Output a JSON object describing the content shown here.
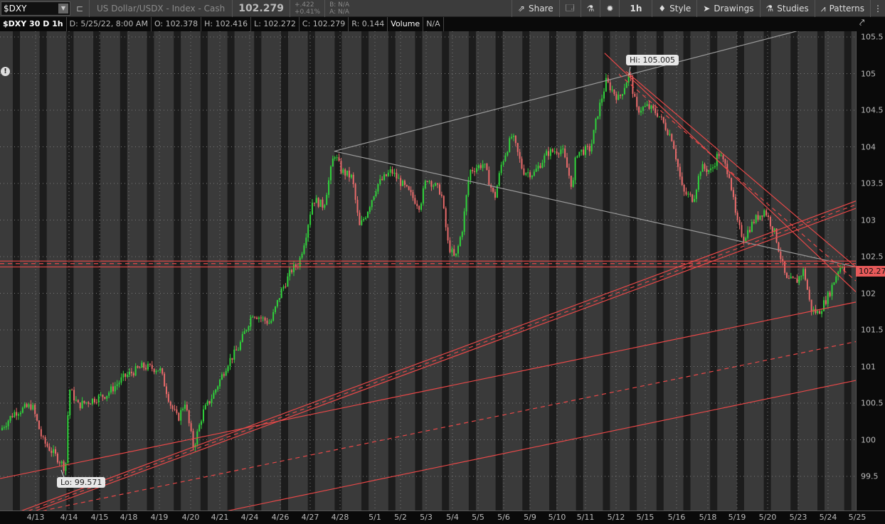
{
  "header": {
    "symbol": "$DXY",
    "description": "US Dollar/USDX - Index - Cash",
    "last": "102.279",
    "change": "+.422",
    "change_pct": "+0.41%",
    "bid": "B: N/A",
    "ask": "A: N/A"
  },
  "toolbar": {
    "share": "Share",
    "timeframe": "1h",
    "style": "Style",
    "drawings": "Drawings",
    "studies": "Studies",
    "patterns": "Patterns"
  },
  "infobar": {
    "title": "$DXY 30 D 1h",
    "date": "D: 5/25/22, 8:00 AM",
    "open": "O: 102.378",
    "high": "H: 102.416",
    "low": "L: 102.272",
    "close": "C: 102.279",
    "range": "R: 0.144",
    "volume_label": "Volume",
    "volume": "N/A"
  },
  "alert": "!",
  "colors": {
    "up": "#2fd13a",
    "down": "#e86a6a",
    "drawing": "#e84848",
    "trendline": "#9a9a9a",
    "background": "#3a3a3a",
    "band": "#1c1c1c"
  },
  "chart_data": {
    "type": "candlestick",
    "symbol": "$DXY",
    "period": "30 D",
    "interval": "1h",
    "current_price": "102.27",
    "hi_label": "Hi: 105.005",
    "lo_label": "Lo: 99.571",
    "y_ticks": [
      "105.5",
      "105",
      "104.5",
      "104",
      "103.5",
      "103",
      "102.5",
      "102",
      "101.5",
      "101",
      "100.5",
      "100",
      "99.5"
    ],
    "x_ticks": [
      "4/13",
      "4/14",
      "4/15",
      "4/18",
      "4/19",
      "4/20",
      "4/21",
      "4/24",
      "4/26",
      "4/27",
      "4/28",
      "5/1",
      "5/2",
      "5/3",
      "5/4",
      "5/5",
      "5/6",
      "5/9",
      "5/10",
      "5/11",
      "5/12",
      "5/15",
      "5/16",
      "5/18",
      "5/19",
      "5/20",
      "5/23",
      "5/24",
      "5/25"
    ],
    "ylim": [
      99.0,
      105.6
    ],
    "price_path": [
      [
        -1.21,
        100.13
      ],
      [
        -0.73,
        100.37
      ],
      [
        -0.12,
        100.47
      ],
      [
        0.24,
        99.99
      ],
      [
        0.85,
        99.7
      ],
      [
        1.02,
        99.6
      ],
      [
        1.14,
        100.71
      ],
      [
        1.45,
        100.47
      ],
      [
        2.42,
        100.62
      ],
      [
        3.03,
        100.86
      ],
      [
        3.64,
        101.0
      ],
      [
        4.24,
        100.96
      ],
      [
        4.61,
        100.47
      ],
      [
        4.85,
        100.28
      ],
      [
        5.09,
        100.52
      ],
      [
        5.38,
        99.89
      ],
      [
        5.7,
        100.37
      ],
      [
        6.06,
        100.62
      ],
      [
        6.55,
        101.05
      ],
      [
        6.91,
        101.25
      ],
      [
        7.39,
        101.73
      ],
      [
        8.0,
        101.59
      ],
      [
        8.36,
        102.02
      ],
      [
        8.73,
        102.32
      ],
      [
        8.97,
        102.41
      ],
      [
        9.21,
        102.8
      ],
      [
        9.45,
        103.29
      ],
      [
        9.82,
        103.19
      ],
      [
        10.18,
        103.92
      ],
      [
        10.42,
        103.67
      ],
      [
        10.79,
        103.58
      ],
      [
        11.03,
        102.9
      ],
      [
        11.27,
        103.09
      ],
      [
        11.64,
        103.48
      ],
      [
        12.12,
        103.67
      ],
      [
        12.61,
        103.43
      ],
      [
        13.09,
        103.19
      ],
      [
        13.33,
        103.58
      ],
      [
        13.82,
        103.38
      ],
      [
        14.06,
        102.66
      ],
      [
        14.3,
        102.46
      ],
      [
        14.55,
        102.9
      ],
      [
        14.79,
        103.67
      ],
      [
        15.27,
        103.77
      ],
      [
        15.64,
        103.29
      ],
      [
        15.88,
        103.77
      ],
      [
        16.24,
        104.16
      ],
      [
        16.61,
        103.67
      ],
      [
        16.97,
        103.63
      ],
      [
        17.45,
        103.92
      ],
      [
        17.94,
        103.97
      ],
      [
        18.3,
        103.43
      ],
      [
        18.42,
        103.92
      ],
      [
        18.91,
        103.97
      ],
      [
        19.15,
        104.45
      ],
      [
        19.44,
        104.89
      ],
      [
        19.88,
        104.65
      ],
      [
        20.24,
        105.0
      ],
      [
        20.48,
        104.5
      ],
      [
        20.85,
        104.55
      ],
      [
        21.21,
        104.45
      ],
      [
        21.7,
        104.11
      ],
      [
        22.06,
        103.38
      ],
      [
        22.42,
        103.29
      ],
      [
        22.67,
        103.72
      ],
      [
        23.03,
        103.67
      ],
      [
        23.27,
        103.92
      ],
      [
        23.64,
        103.63
      ],
      [
        23.88,
        102.99
      ],
      [
        24.12,
        102.75
      ],
      [
        24.48,
        102.99
      ],
      [
        24.85,
        103.14
      ],
      [
        25.21,
        102.8
      ],
      [
        25.58,
        102.17
      ],
      [
        25.94,
        102.17
      ],
      [
        26.18,
        102.32
      ],
      [
        26.42,
        101.78
      ],
      [
        26.67,
        101.73
      ],
      [
        27.03,
        101.98
      ],
      [
        27.35,
        102.32
      ],
      [
        27.52,
        102.41
      ],
      [
        27.6,
        102.28
      ]
    ],
    "drawings": [
      {
        "kind": "trend",
        "color": "gray",
        "from": [
          10.18,
          103.94
        ],
        "to": [
          25.94,
          105.58
        ]
      },
      {
        "kind": "trend",
        "color": "gray",
        "from": [
          10.18,
          103.94
        ],
        "to": [
          27.95,
          102.36
        ]
      },
      {
        "kind": "hline",
        "color": "red",
        "price": 102.44
      },
      {
        "kind": "hline",
        "color": "red",
        "price": 102.405,
        "dashed": true
      },
      {
        "kind": "hline",
        "color": "red",
        "price": 102.36
      },
      {
        "kind": "trend",
        "color": "red",
        "from": [
          19.39,
          105.28
        ],
        "to": [
          27.95,
          102.02
        ]
      },
      {
        "kind": "trend",
        "color": "red",
        "from": [
          19.88,
          104.99
        ],
        "to": [
          27.95,
          102.17
        ],
        "dashed": true
      },
      {
        "kind": "trend",
        "color": "red",
        "from": [
          20.12,
          105.03
        ],
        "to": [
          27.95,
          102.36
        ]
      },
      {
        "kind": "trend",
        "color": "red",
        "from": [
          -0.48,
          99.03
        ],
        "to": [
          27.95,
          103.26
        ]
      },
      {
        "kind": "trend",
        "color": "red",
        "from": [
          -0.24,
          99.03
        ],
        "to": [
          27.95,
          103.21
        ],
        "dashed": true
      },
      {
        "kind": "trend",
        "color": "red",
        "from": [
          0,
          99.03
        ],
        "to": [
          27.95,
          103.16
        ]
      },
      {
        "kind": "trend",
        "color": "red",
        "from": [
          -1.21,
          99.47
        ],
        "to": [
          27.95,
          101.88
        ]
      },
      {
        "kind": "trend",
        "color": "red",
        "from": [
          0.24,
          99.03
        ],
        "to": [
          27.95,
          101.34
        ],
        "dashed": true
      },
      {
        "kind": "trend",
        "color": "red",
        "from": [
          6.55,
          99.03
        ],
        "to": [
          27.95,
          100.81
        ]
      }
    ]
  }
}
